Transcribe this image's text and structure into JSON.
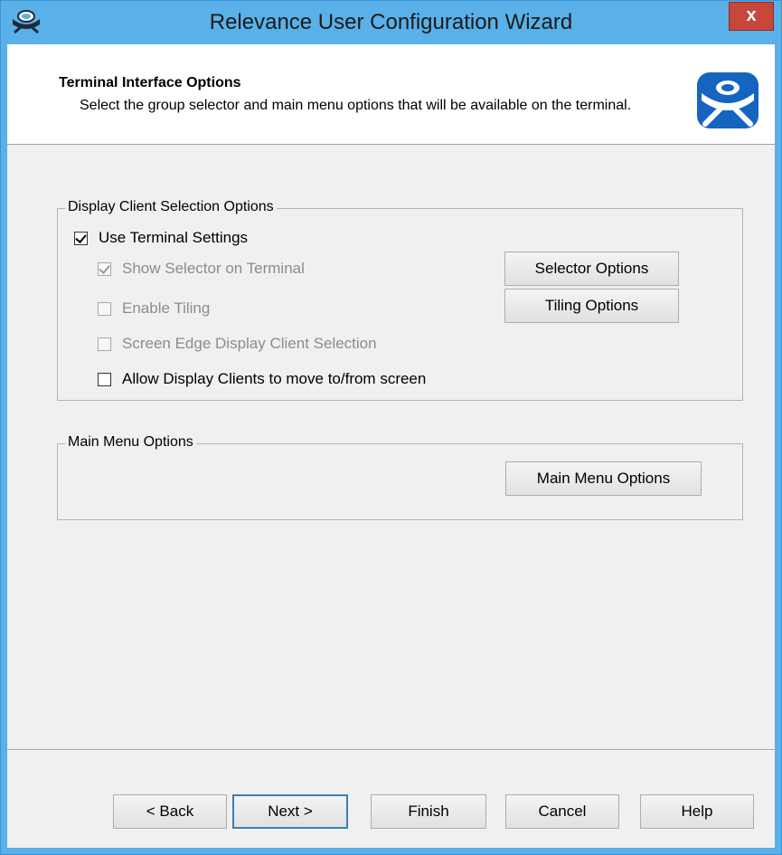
{
  "window": {
    "title": "Relevance User Configuration Wizard",
    "close_label": "x"
  },
  "header": {
    "title": "Terminal Interface Options",
    "description": "Select the group selector and main menu options that will be available on the terminal."
  },
  "display_group": {
    "legend": "Display Client Selection Options",
    "use_terminal_settings": {
      "label": "Use Terminal Settings",
      "checked": true
    },
    "show_selector": {
      "label": "Show Selector on Terminal",
      "checked": true,
      "enabled": false
    },
    "enable_tiling": {
      "label": "Enable Tiling",
      "checked": false,
      "enabled": false
    },
    "screen_edge": {
      "label": "Screen Edge Display Client Selection",
      "checked": false,
      "enabled": false
    },
    "allow_move": {
      "label": "Allow Display Clients to move to/from screen",
      "checked": false
    },
    "selector_options_label": "Selector Options",
    "tiling_options_label": "Tiling Options"
  },
  "main_menu_group": {
    "legend": "Main Menu Options",
    "button_label": "Main Menu Options"
  },
  "footer": {
    "back_label": "< Back",
    "next_label": "Next >",
    "finish_label": "Finish",
    "cancel_label": "Cancel",
    "help_label": "Help"
  },
  "colors": {
    "titlebar": "#5ab0e8",
    "close": "#c7473c",
    "logo": "#1565c0"
  }
}
